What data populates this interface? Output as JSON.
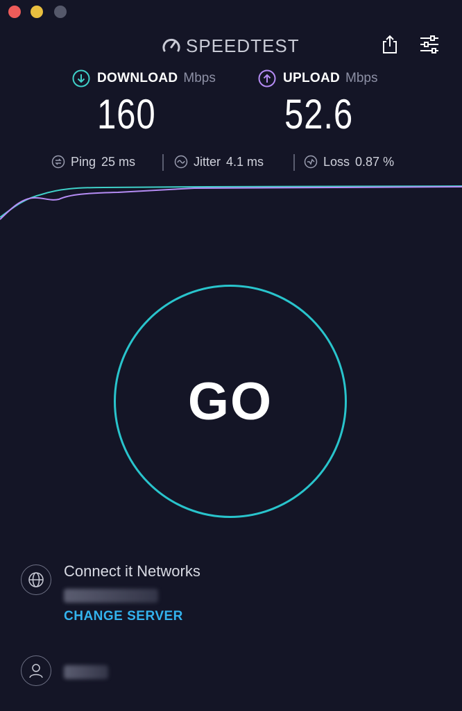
{
  "window": {
    "controls": [
      "close",
      "minimize",
      "zoom"
    ]
  },
  "header": {
    "brand": "SPEEDTEST",
    "brand_icon": "speedometer-icon",
    "share_icon": "share-icon",
    "settings_icon": "sliders-icon"
  },
  "download": {
    "label": "DOWNLOAD",
    "unit": "Mbps",
    "value": "160",
    "icon": "arrow-down-circle-icon",
    "color": "#3fd0c8"
  },
  "upload": {
    "label": "UPLOAD",
    "unit": "Mbps",
    "value": "52.6",
    "icon": "arrow-up-circle-icon",
    "color": "#b58cf4"
  },
  "stats": {
    "ping": {
      "label": "Ping",
      "value": "25 ms",
      "icon": "ping-icon"
    },
    "jitter": {
      "label": "Jitter",
      "value": "4.1 ms",
      "icon": "jitter-icon"
    },
    "loss": {
      "label": "Loss",
      "value": "0.87 %",
      "icon": "loss-icon"
    }
  },
  "go_button": {
    "label": "GO",
    "ring_color": "#29c4cc"
  },
  "server": {
    "name": "Connect it Networks",
    "location": "",
    "change_label": "CHANGE SERVER",
    "icon": "globe-icon"
  },
  "account": {
    "name": "",
    "icon": "user-icon"
  },
  "colors": {
    "background": "#141526",
    "accent_blue": "#33b3ee"
  }
}
